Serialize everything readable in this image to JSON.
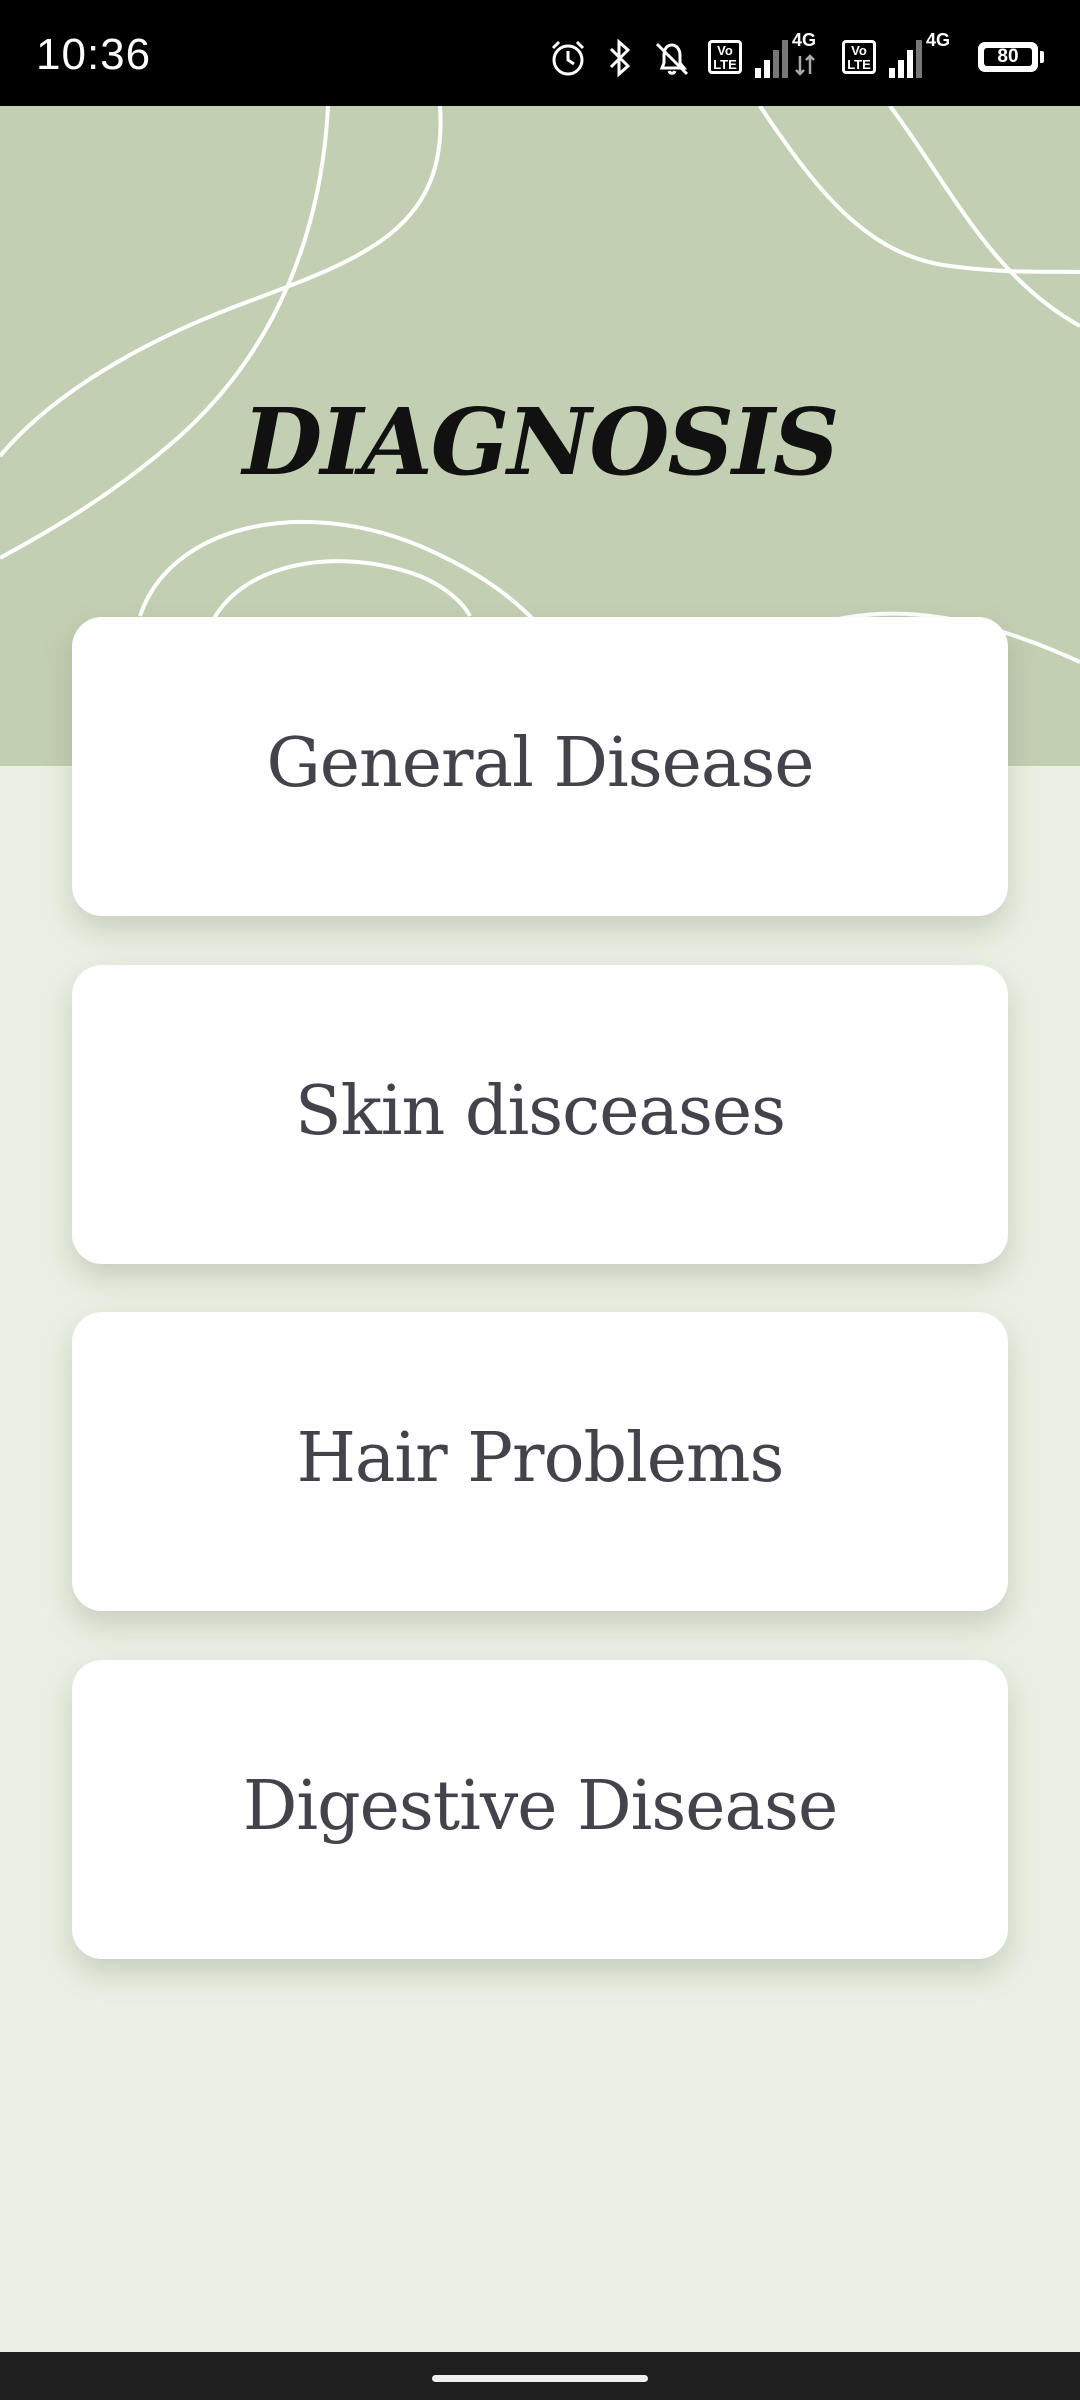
{
  "status_bar": {
    "time": "10:36",
    "battery": "80",
    "network_1": "4G",
    "network_2": "4G",
    "volte_1": "Vo LTE",
    "volte_2": "Vo LTE",
    "icons": [
      "alarm-icon",
      "bluetooth-icon",
      "mute-bell-icon",
      "volte-icon",
      "signal-icon",
      "volte-icon",
      "signal-icon",
      "battery-icon"
    ]
  },
  "header": {
    "title": "DIAGNOSIS",
    "background_color": "#c3cfb2"
  },
  "categories": [
    {
      "label": "General Disease"
    },
    {
      "label": "Skin disceases"
    },
    {
      "label": "Hair Problems"
    },
    {
      "label": "Digestive Disease"
    }
  ],
  "colors": {
    "page_background": "#eaf0e4",
    "card_background": "#ffffff",
    "card_text": "#44434b"
  }
}
